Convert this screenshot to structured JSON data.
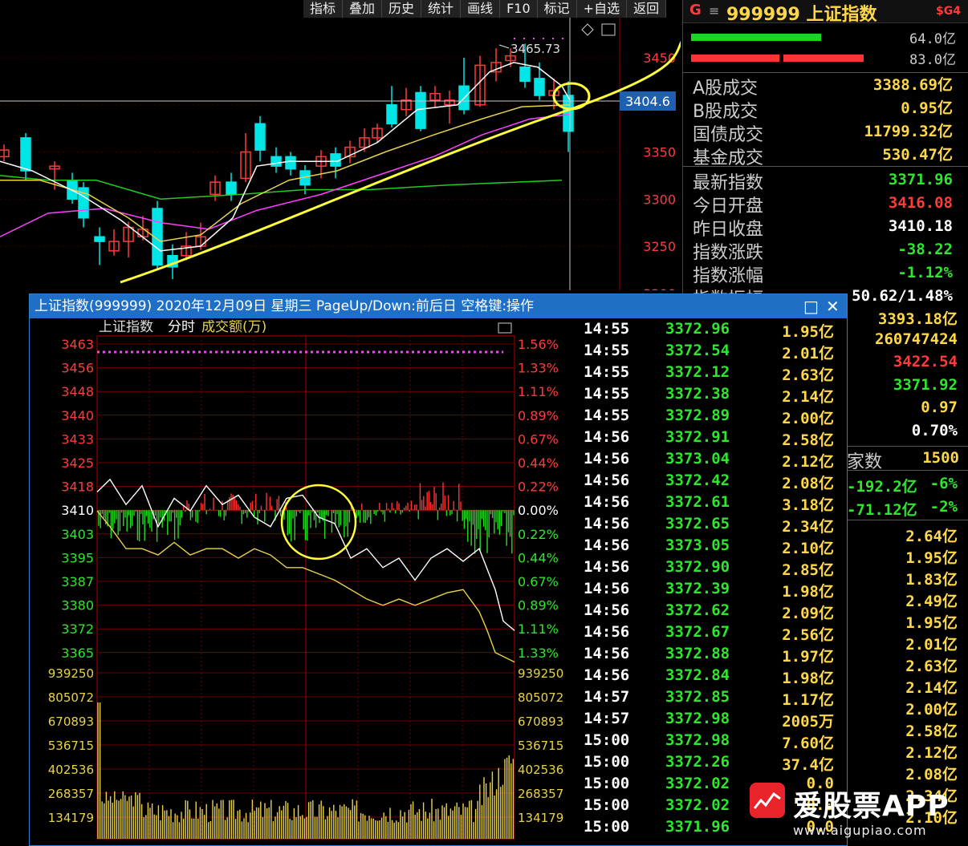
{
  "toolbar": [
    "指标",
    "叠加",
    "历史",
    "统计",
    "画线",
    "F10",
    "标记",
    "+自选",
    "返回"
  ],
  "main_chart": {
    "high_label": "3465.73",
    "crosshair_price": "3404.6",
    "y_ticks": [
      "3450",
      "3400",
      "3350",
      "3300",
      "3250",
      "3200"
    ],
    "colors": {
      "up": "#ff3b3b",
      "down": "#00e5e5",
      "ma5": "#ffffff",
      "ma10": "#e8d24a",
      "ma20": "#ff40ff",
      "ma60": "#22cc22",
      "trend": "#ffff3a"
    }
  },
  "right_panel": {
    "header": {
      "g": "G",
      "menu": "≡",
      "code": "999999 上证指数",
      "sg": "$G4"
    },
    "bars": [
      {
        "value": "64.0亿",
        "color": "#22d422"
      },
      {
        "value": "83.0亿",
        "color": "#ff3333"
      }
    ],
    "rows1": [
      {
        "label": "A股成交",
        "value": "3388.69亿"
      },
      {
        "label": "B股成交",
        "value": "0.95亿"
      },
      {
        "label": "国债成交",
        "value": "11799.32亿"
      },
      {
        "label": "基金成交",
        "value": "530.47亿"
      }
    ],
    "rows2": [
      {
        "label": "最新指数",
        "value": "3371.96",
        "color": "#2ee62e"
      },
      {
        "label": "今日开盘",
        "value": "3416.08",
        "color": "#ff3b3b"
      },
      {
        "label": "昨日收盘",
        "value": "3410.18",
        "color": "#ffffff"
      },
      {
        "label": "指数涨跌",
        "value": "-38.22",
        "color": "#2ee62e"
      },
      {
        "label": "指数涨幅",
        "value": "-1.12%",
        "color": "#2ee62e"
      },
      {
        "label": "指数振幅",
        "value": "50.62/1.48%",
        "color": "#ffffff"
      }
    ],
    "hidden_values": [
      {
        "value": "3393.18亿",
        "color": "#ffd84a"
      },
      {
        "value": "260747424",
        "color": "#ffd84a"
      },
      {
        "value": "3422.54",
        "color": "#ff3b3b"
      },
      {
        "value": "3371.92",
        "color": "#2ee62e"
      },
      {
        "value": "0.97",
        "color": "#ffd84a"
      },
      {
        "value": "0.70%",
        "color": "#ffffff"
      }
    ],
    "jia_label": "家数",
    "jia_value": "1500",
    "flows": [
      {
        "amount": "-192.2亿",
        "pct": "-6%"
      },
      {
        "amount": "-71.12亿",
        "pct": "-2%"
      }
    ],
    "volumes": [
      "2.64亿",
      "1.95亿",
      "1.83亿",
      "2.49亿",
      "1.95亿",
      "2.01亿",
      "2.63亿",
      "2.14亿",
      "2.00亿",
      "2.58亿",
      "2.12亿",
      "2.08亿",
      "2.34亿",
      "2.10亿"
    ]
  },
  "popup": {
    "title": "上证指数(999999) 2020年12月09日 星期三 PageUp/Down:前后日 空格键:操作",
    "min_btn": "□",
    "close_btn": "✕",
    "chart_label": "上证指数",
    "mode_label": "分时",
    "vol_label": "成交额(万)",
    "price_ticks": [
      "3463",
      "3456",
      "3448",
      "3440",
      "3433",
      "3425",
      "3418",
      "3410",
      "3403",
      "3395",
      "3387",
      "3380",
      "3372",
      "3365"
    ],
    "pct_ticks": [
      "1.56%",
      "1.33%",
      "1.11%",
      "0.89%",
      "0.67%",
      "0.44%",
      "0.22%",
      "0.00%",
      "0.22%",
      "0.44%",
      "0.67%",
      "0.89%",
      "1.11%",
      "1.33%"
    ],
    "vol_ticks": [
      "939250",
      "805072",
      "670893",
      "536715",
      "402536",
      "268357",
      "134179"
    ],
    "ticks": [
      {
        "t": "14:55",
        "p": "3372.96",
        "v": "1.95亿"
      },
      {
        "t": "14:55",
        "p": "3372.54",
        "v": "2.01亿"
      },
      {
        "t": "14:55",
        "p": "3372.12",
        "v": "2.63亿"
      },
      {
        "t": "14:55",
        "p": "3372.38",
        "v": "2.14亿"
      },
      {
        "t": "14:55",
        "p": "3372.89",
        "v": "2.00亿"
      },
      {
        "t": "14:56",
        "p": "3372.91",
        "v": "2.58亿"
      },
      {
        "t": "14:56",
        "p": "3373.04",
        "v": "2.12亿"
      },
      {
        "t": "14:56",
        "p": "3372.42",
        "v": "2.08亿"
      },
      {
        "t": "14:56",
        "p": "3372.61",
        "v": "3.18亿"
      },
      {
        "t": "14:56",
        "p": "3372.65",
        "v": "2.34亿"
      },
      {
        "t": "14:56",
        "p": "3373.05",
        "v": "2.10亿"
      },
      {
        "t": "14:56",
        "p": "3372.90",
        "v": "2.85亿"
      },
      {
        "t": "14:56",
        "p": "3372.39",
        "v": "1.98亿"
      },
      {
        "t": "14:56",
        "p": "3372.62",
        "v": "2.09亿"
      },
      {
        "t": "14:56",
        "p": "3372.67",
        "v": "2.56亿"
      },
      {
        "t": "14:56",
        "p": "3372.88",
        "v": "1.97亿"
      },
      {
        "t": "14:56",
        "p": "3372.84",
        "v": "1.98亿"
      },
      {
        "t": "14:57",
        "p": "3372.85",
        "v": "1.17亿"
      },
      {
        "t": "14:57",
        "p": "3372.98",
        "v": "2005万"
      },
      {
        "t": "15:00",
        "p": "3372.98",
        "v": "7.60亿"
      },
      {
        "t": "15:00",
        "p": "3372.26",
        "v": "37.4亿"
      },
      {
        "t": "15:00",
        "p": "3372.02",
        "v": "0.0"
      },
      {
        "t": "15:00",
        "p": "3372.02",
        "v": "0.0"
      },
      {
        "t": "15:00",
        "p": "3371.96",
        "v": "0.0"
      }
    ]
  },
  "watermark": {
    "brand": "爱股票APP",
    "url": "www.aigupiao.com"
  }
}
